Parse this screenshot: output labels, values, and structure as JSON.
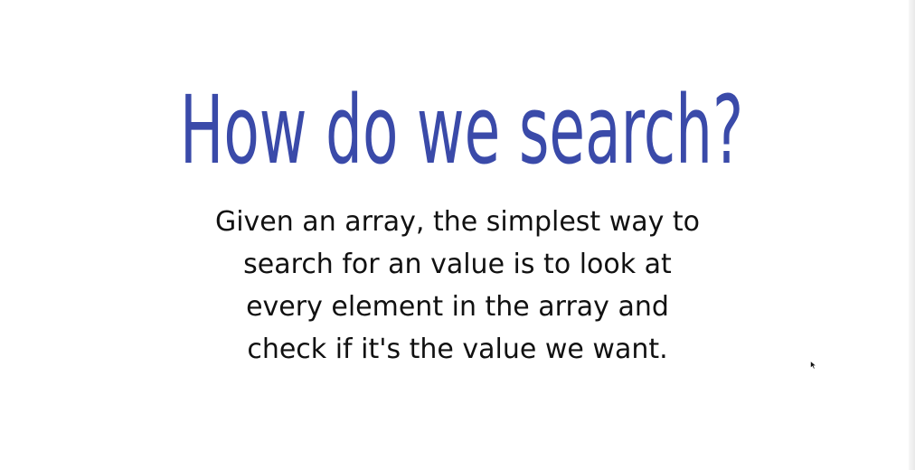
{
  "slide": {
    "title": "How do we search?",
    "body_lines": [
      "Given an array, the simplest way to",
      "search for an value is to look at",
      "every element in the array and",
      "check if it's the value we want."
    ]
  },
  "colors": {
    "title": "#3a4aa9",
    "body_text": "#111111",
    "background": "#ffffff"
  },
  "icons": {
    "pointer": "mouse-cursor-icon"
  }
}
